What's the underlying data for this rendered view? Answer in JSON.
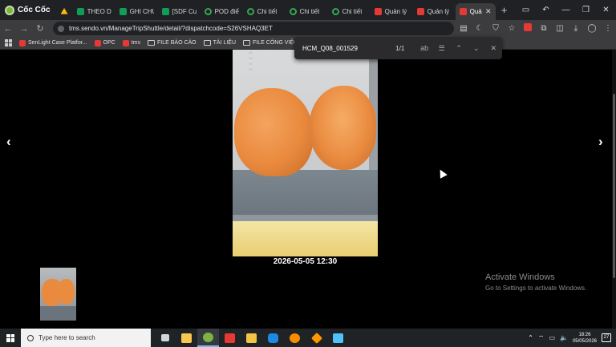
{
  "browser": {
    "brand": "Cốc Cốc",
    "tabs": [
      {
        "label": "",
        "favicon": "drive-icon",
        "color": "#fbbc04"
      },
      {
        "label": "THEO DÕ",
        "favicon": "sheets-icon",
        "color": "#0f9d58"
      },
      {
        "label": "GHI CHÚ",
        "favicon": "sheets-icon",
        "color": "#0f9d58"
      },
      {
        "label": "[SDF Cu",
        "favicon": "sheets-icon",
        "color": "#0f9d58"
      },
      {
        "label": "POD điể",
        "favicon": "web-icon",
        "color": "#34a853"
      },
      {
        "label": "Chi tiết",
        "favicon": "web-icon",
        "color": "#34a853"
      },
      {
        "label": "Chi tiết",
        "favicon": "web-icon",
        "color": "#34a853"
      },
      {
        "label": "Chi tiết",
        "favicon": "web-icon",
        "color": "#34a853"
      },
      {
        "label": "Quản lý",
        "favicon": "sendo-icon",
        "color": "#e53935"
      },
      {
        "label": "Quản lý",
        "favicon": "sendo-icon",
        "color": "#e53935"
      }
    ],
    "active_tab": {
      "label": "Quả",
      "favicon": "sendo-icon",
      "color": "#e53935"
    },
    "url": "tms.sendo.vn/ManageTripShuttle/detail/?dispatchcode=S26VSHAQ3ET",
    "bookmarks": [
      {
        "label": "SenLight Case Platfor...",
        "type": "site"
      },
      {
        "label": "OPC",
        "type": "site"
      },
      {
        "label": "tms",
        "type": "site"
      },
      {
        "label": "FILE BÁO CÁO",
        "type": "folder"
      },
      {
        "label": "TÀI LIỆU",
        "type": "folder"
      },
      {
        "label": "FILE CÔNG VIỆC",
        "type": "folder"
      }
    ],
    "find_bar": {
      "query": "HCM_Q08_001529",
      "match_count": "1/1",
      "ab_label": "ab"
    }
  },
  "viewer": {
    "photo_stamp_lines": [
      "...",
      "...",
      "...",
      "..."
    ],
    "timestamp": "2026-05-05 12:30",
    "prev_arrow": "‹",
    "next_arrow": "›"
  },
  "watermark": {
    "title": "Activate Windows",
    "subtitle": "Go to Settings to activate Windows."
  },
  "taskbar": {
    "search_placeholder": "Type here to search",
    "apps": [
      {
        "name": "task-view-icon",
        "color": "#cfd8dc"
      },
      {
        "name": "file-explorer-icon",
        "color": "#f9c74f"
      },
      {
        "name": "coccoc-icon",
        "color": "#7cb342"
      },
      {
        "name": "wps-icon",
        "color": "#e53935"
      },
      {
        "name": "sticky-notes-icon",
        "color": "#f4c542"
      },
      {
        "name": "zalo-icon",
        "color": "#1e88e5"
      },
      {
        "name": "chrome-icon",
        "color": "#fb8c00"
      },
      {
        "name": "app-orange-icon",
        "color": "#ff9800"
      },
      {
        "name": "app-blue-icon",
        "color": "#4fc3f7"
      }
    ],
    "time": "18:26",
    "date": "05/05/2026",
    "notification_count": "27"
  }
}
